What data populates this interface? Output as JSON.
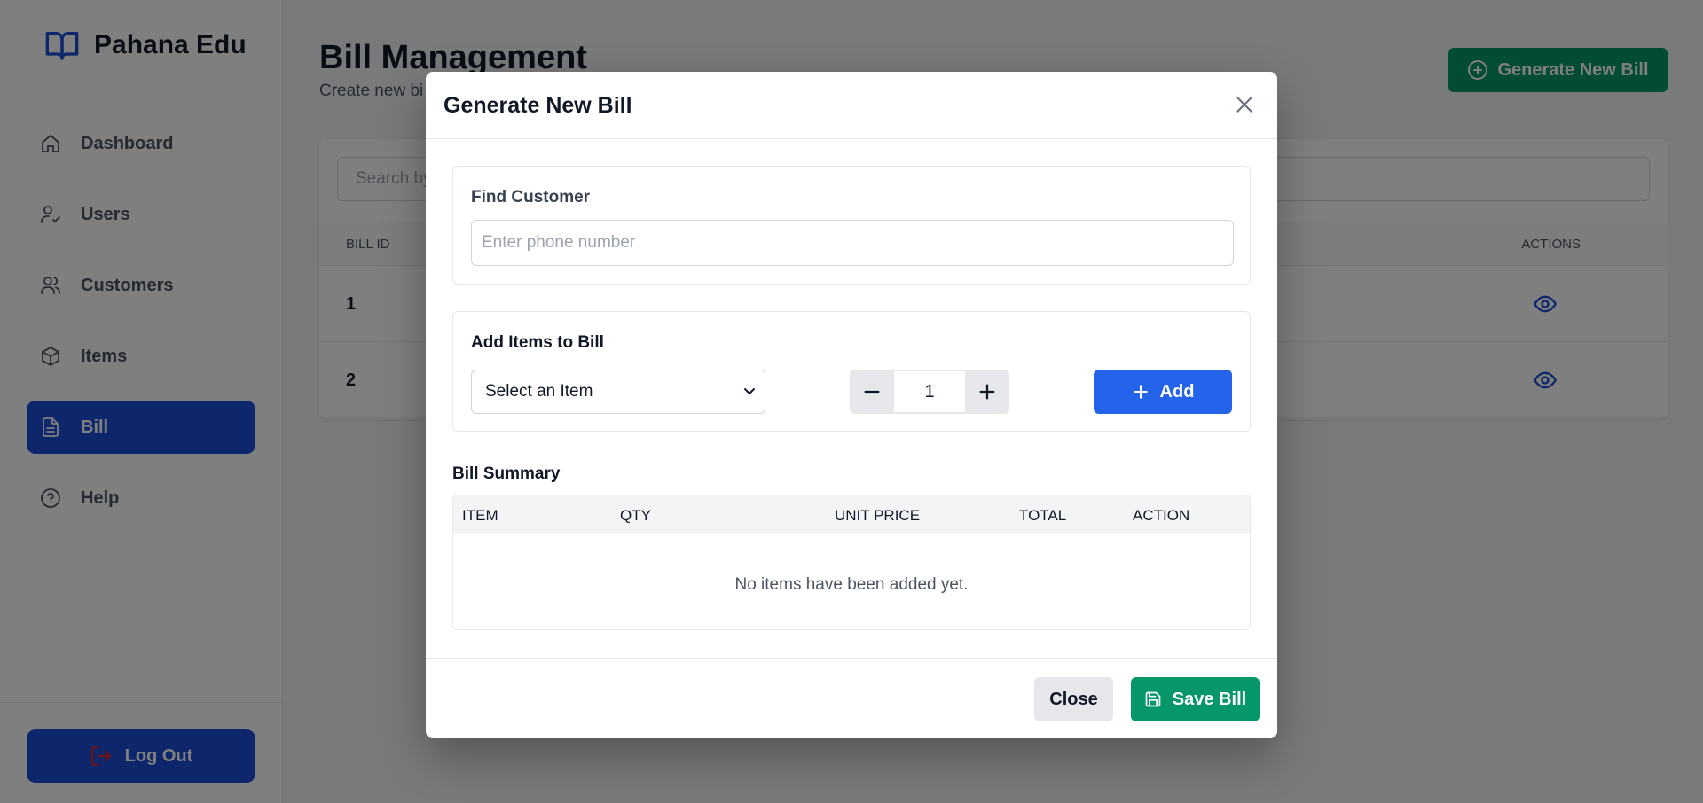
{
  "brand": {
    "name": "Pahana Edu",
    "icon": "book-open-icon",
    "color": "#1d4ed8"
  },
  "sidebar": {
    "items": [
      {
        "label": "Dashboard",
        "icon": "home-icon"
      },
      {
        "label": "Users",
        "icon": "user-check-icon"
      },
      {
        "label": "Customers",
        "icon": "users-icon"
      },
      {
        "label": "Items",
        "icon": "cube-icon"
      },
      {
        "label": "Bill",
        "icon": "document-icon",
        "active": true
      },
      {
        "label": "Help",
        "icon": "help-circle-icon"
      }
    ],
    "logout_label": "Log Out"
  },
  "page": {
    "title": "Bill Management",
    "subtitle": "Create new bi",
    "generate_button": "Generate New Bill",
    "search_placeholder": "Search by",
    "table": {
      "headers": {
        "bill_id": "BILL ID",
        "actions": "ACTIONS"
      },
      "rows": [
        {
          "id": "1"
        },
        {
          "id": "2"
        }
      ]
    }
  },
  "modal": {
    "title": "Generate New Bill",
    "find_customer": {
      "label": "Find Customer",
      "placeholder": "Enter phone number"
    },
    "add_items": {
      "label": "Add Items to Bill",
      "select_value": "Select an Item",
      "quantity": "1",
      "add_button": "Add"
    },
    "summary": {
      "title": "Bill Summary",
      "headers": [
        "ITEM",
        "QTY",
        "UNIT PRICE",
        "TOTAL",
        "ACTION"
      ],
      "empty_message": "No items have been added yet."
    },
    "footer": {
      "close_button": "Close",
      "save_button": "Save Bill"
    }
  },
  "colors": {
    "primary": "#1d4ed8",
    "accent_blue": "#2563eb",
    "success": "#059669"
  }
}
